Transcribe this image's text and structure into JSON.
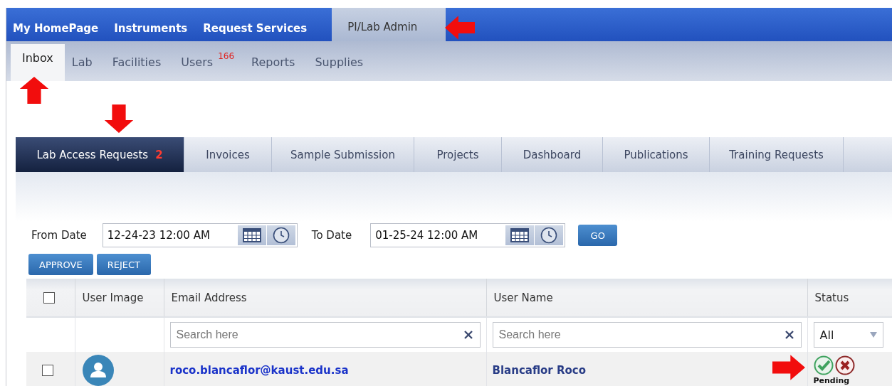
{
  "top_nav": [
    {
      "label": "My HomePage",
      "selected": false
    },
    {
      "label": "Instruments",
      "selected": false
    },
    {
      "label": "Request Services",
      "selected": false
    },
    {
      "label": "PI/Lab Admin",
      "selected": true
    }
  ],
  "sub_nav": [
    {
      "label": "Inbox",
      "selected": true
    },
    {
      "label": "Lab",
      "selected": false
    },
    {
      "label": "Facilities",
      "selected": false
    },
    {
      "label": "Users",
      "badge": "166",
      "selected": false
    },
    {
      "label": "Reports",
      "selected": false
    },
    {
      "label": "Supplies",
      "selected": false
    }
  ],
  "section_tabs": [
    {
      "label": "Lab Access Requests",
      "badge": "2",
      "selected": true
    },
    {
      "label": "Invoices",
      "selected": false
    },
    {
      "label": "Sample Submission",
      "selected": false
    },
    {
      "label": "Projects",
      "selected": false
    },
    {
      "label": "Dashboard",
      "selected": false
    },
    {
      "label": "Publications",
      "selected": false
    },
    {
      "label": "Training Requests",
      "selected": false
    }
  ],
  "filters": {
    "from_label": "From Date",
    "from_value": "12-24-23 12:00 AM",
    "to_label": "To Date",
    "to_value": "01-25-24 12:00 AM",
    "go": "GO"
  },
  "actions": [
    "APPROVE",
    "REJECT"
  ],
  "table": {
    "header_checked": false,
    "columns": [
      "User Image",
      "Email Address",
      "User Name",
      "Status"
    ],
    "search": [
      {
        "placeholder": "Search here"
      },
      {
        "placeholder": "Search here"
      }
    ],
    "status_filter": "All",
    "rows": [
      {
        "checked": false,
        "email": "roco.blancaflor@kaust.edu.sa",
        "name": "Blancaflor Roco",
        "status": "Pending"
      }
    ]
  },
  "annotations": [
    {
      "kind": "arrow"
    },
    {
      "kind": "arrow"
    },
    {
      "kind": "arrow"
    },
    {
      "kind": "arrow"
    }
  ]
}
